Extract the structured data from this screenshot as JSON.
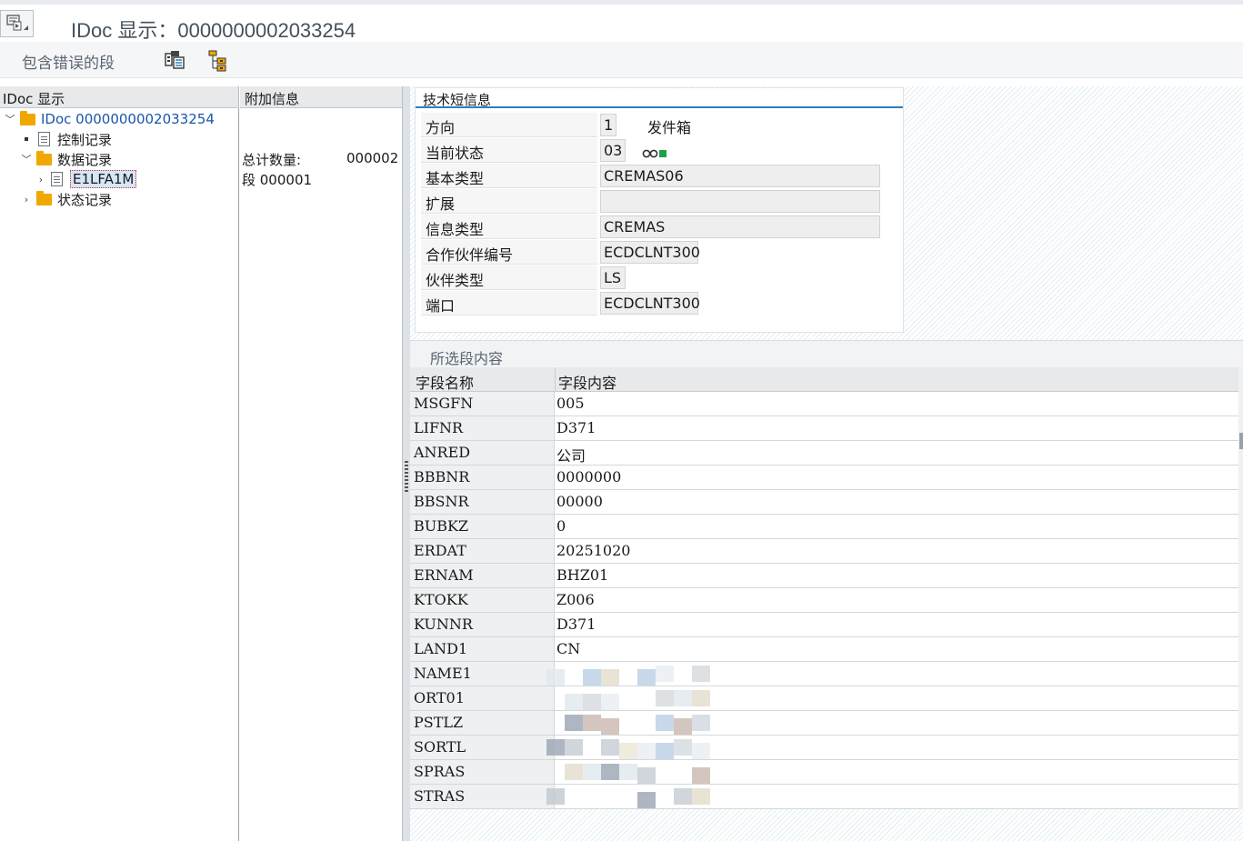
{
  "window": {
    "title": "IDoc 显示：0000000002033254"
  },
  "toolbar": {
    "errors_label": "包含错误的段",
    "icons": [
      "display-details-icon",
      "hierarchy-icon"
    ]
  },
  "tree": {
    "header": "IDoc 显示",
    "root_label": "IDoc 0000000002033254",
    "control_label": "控制记录",
    "data_label": "数据记录",
    "segment_label": "E1LFA1M",
    "status_label": "状态记录"
  },
  "info": {
    "header": "附加信息",
    "total_label": "总计数量:",
    "total_value": "000002",
    "segment_line": "段 000001"
  },
  "tech": {
    "title": "技术短信息",
    "rows": [
      {
        "label": "方向",
        "value": "1",
        "extra": "发件箱"
      },
      {
        "label": "当前状态",
        "value": "03",
        "extra": ""
      },
      {
        "label": "基本类型",
        "value": "CREMAS06",
        "extra": ""
      },
      {
        "label": "扩展",
        "value": "",
        "extra": ""
      },
      {
        "label": "信息类型",
        "value": "CREMAS",
        "extra": ""
      },
      {
        "label": "合作伙伴编号",
        "value": "ECDCLNT300",
        "extra": ""
      },
      {
        "label": "伙伴类型",
        "value": "LS",
        "extra": ""
      },
      {
        "label": "端口",
        "value": "ECDCLNT300",
        "extra": ""
      }
    ],
    "status_color": "#1aa34a"
  },
  "segment": {
    "title": "所选段内容",
    "col_name": "字段名称",
    "col_value": "字段内容",
    "rows": [
      {
        "name": "MSGFN",
        "value": "005"
      },
      {
        "name": "LIFNR",
        "value": "D371"
      },
      {
        "name": "ANRED",
        "value": "公司"
      },
      {
        "name": "BBBNR",
        "value": "0000000"
      },
      {
        "name": "BBSNR",
        "value": "00000"
      },
      {
        "name": "BUBKZ",
        "value": "0"
      },
      {
        "name": "ERDAT",
        "value": "20251020"
      },
      {
        "name": "ERNAM",
        "value": "BHZ01"
      },
      {
        "name": "KTOKK",
        "value": "Z006"
      },
      {
        "name": "KUNNR",
        "value": "D371"
      },
      {
        "name": "LAND1",
        "value": "CN"
      },
      {
        "name": "NAME1",
        "value": ""
      },
      {
        "name": "ORT01",
        "value": ""
      },
      {
        "name": "PSTLZ",
        "value": ""
      },
      {
        "name": "SORTL",
        "value": ""
      },
      {
        "name": "SPRAS",
        "value": ""
      },
      {
        "name": "STRAS",
        "value": ""
      }
    ]
  }
}
